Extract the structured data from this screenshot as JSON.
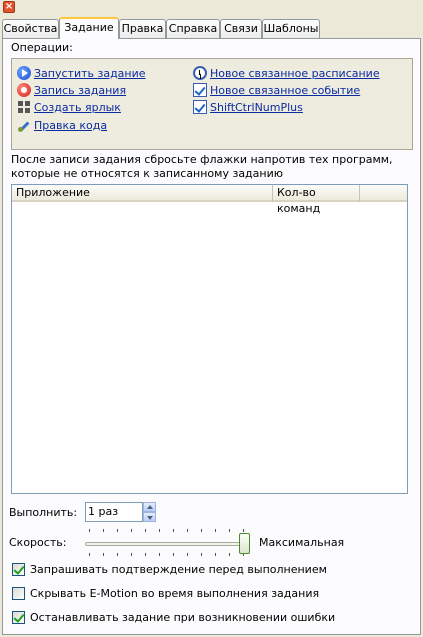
{
  "window": {
    "close_glyph": "×"
  },
  "tabs": [
    {
      "label": "Свойства",
      "active": false
    },
    {
      "label": "Задание",
      "active": true
    },
    {
      "label": "Правка",
      "active": false
    },
    {
      "label": "Справка",
      "active": false
    },
    {
      "label": "Связи",
      "active": false
    },
    {
      "label": "Шаблоны",
      "active": false
    }
  ],
  "operations": {
    "label": "Операции:",
    "items": [
      {
        "label": "Запустить задание",
        "icon": "play-icon"
      },
      {
        "label": "Запись задания",
        "icon": "record-icon"
      },
      {
        "label": "Создать ярлык",
        "icon": "shortcut-icon"
      },
      {
        "label": "Правка кода",
        "icon": "edit-code-icon"
      },
      {
        "label": "Новое связанное расписание",
        "icon": "schedule-icon"
      },
      {
        "label": "Новое связанное событие",
        "icon": "event-icon"
      },
      {
        "label": "ShiftCtrlNumPlus",
        "icon": "hotkey-icon"
      }
    ]
  },
  "notice": {
    "line1": "После записи задания сбросьте флажки напротив тех программ,",
    "line2": "которые не относятся к записанному заданию"
  },
  "table": {
    "columns": [
      "Приложение",
      "Кол-во команд"
    ],
    "rows": []
  },
  "execute": {
    "label": "Выполнить:",
    "value": "1 раз"
  },
  "speed": {
    "label": "Скорость:",
    "value_label": "Максимальная",
    "level": 1.0
  },
  "options": [
    {
      "label": "Запрашивать подтверждение перед выполнением",
      "checked": true
    },
    {
      "label": "Скрывать E-Motion во время выполнения задания",
      "checked": false
    },
    {
      "label": "Останавливать задание при возникновении ошибки",
      "checked": true
    }
  ],
  "colors": {
    "link": "#0b2ba1",
    "active_tab_accent": "#ffc83c",
    "panel_bg": "#fcfcfe",
    "ops_bg": "#eeecde"
  }
}
